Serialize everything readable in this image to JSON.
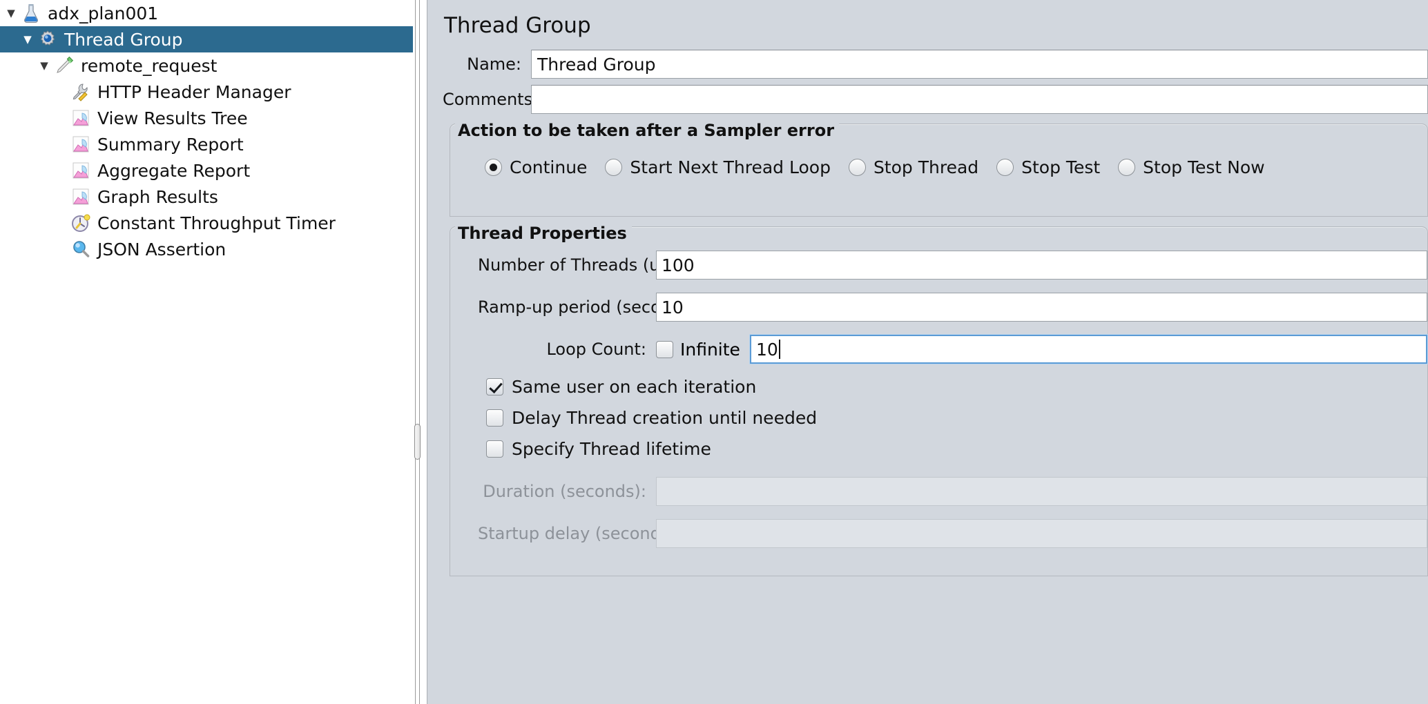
{
  "tree": {
    "items": [
      {
        "label": "adx_plan001",
        "icon": "test-plan-icon",
        "depth": 0,
        "twisty": "▼",
        "selected": false
      },
      {
        "label": "Thread Group",
        "icon": "thread-group-icon",
        "depth": 1,
        "twisty": "▼",
        "selected": true
      },
      {
        "label": "remote_request",
        "icon": "http-request-icon",
        "depth": 2,
        "twisty": "▼",
        "selected": false
      },
      {
        "label": "HTTP Header Manager",
        "icon": "header-manager-icon",
        "depth": 3,
        "twisty": "",
        "selected": false
      },
      {
        "label": "View Results Tree",
        "icon": "listener-chart-icon",
        "depth": 3,
        "twisty": "",
        "selected": false
      },
      {
        "label": "Summary Report",
        "icon": "listener-chart-icon",
        "depth": 3,
        "twisty": "",
        "selected": false
      },
      {
        "label": "Aggregate Report",
        "icon": "listener-chart-icon",
        "depth": 3,
        "twisty": "",
        "selected": false
      },
      {
        "label": "Graph Results",
        "icon": "listener-chart-icon",
        "depth": 3,
        "twisty": "",
        "selected": false
      },
      {
        "label": "Constant Throughput Timer",
        "icon": "timer-clock-icon",
        "depth": 3,
        "twisty": "",
        "selected": false
      },
      {
        "label": "JSON Assertion",
        "icon": "assertion-magnifier-icon",
        "depth": 3,
        "twisty": "",
        "selected": false
      }
    ]
  },
  "panel": {
    "title": "Thread Group",
    "name_label": "Name:",
    "name_value": "Thread Group",
    "comments_label": "Comments:",
    "comments_value": "",
    "sampler_error": {
      "group_title": "Action to be taken after a Sampler error",
      "options": [
        {
          "label": "Continue",
          "checked": true
        },
        {
          "label": "Start Next Thread Loop",
          "checked": false
        },
        {
          "label": "Stop Thread",
          "checked": false
        },
        {
          "label": "Stop Test",
          "checked": false
        },
        {
          "label": "Stop Test Now",
          "checked": false
        }
      ]
    },
    "thread_properties": {
      "group_title": "Thread Properties",
      "num_threads_label": "Number of Threads (users):",
      "num_threads_value": "100",
      "ramp_up_label": "Ramp-up period (seconds):",
      "ramp_up_value": "10",
      "loop_count_label": "Loop Count:",
      "infinite_label": "Infinite",
      "infinite_checked": false,
      "loop_count_value": "10",
      "same_user_label": "Same user on each iteration",
      "same_user_checked": true,
      "delay_thread_label": "Delay Thread creation until needed",
      "delay_thread_checked": false,
      "specify_lifetime_label": "Specify Thread lifetime",
      "specify_lifetime_checked": false,
      "duration_label": "Duration (seconds):",
      "duration_value": "",
      "startup_delay_label": "Startup delay (seconds):",
      "startup_delay_value": ""
    }
  },
  "colors": {
    "selection": "#2c6a8f",
    "panel_bg": "#d2d7de",
    "focus_ring": "#5b9bd5"
  }
}
